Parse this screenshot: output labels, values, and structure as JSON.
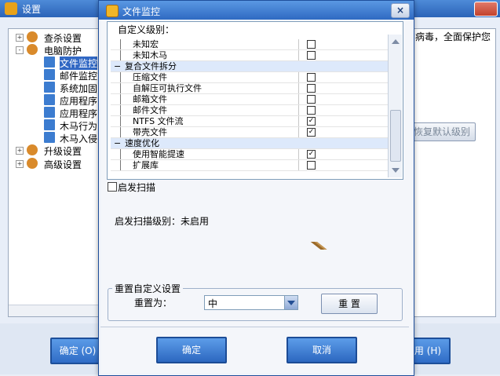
{
  "background_window": {
    "title": "设置",
    "tree": [
      {
        "label": "查杀设置",
        "level": 0,
        "expander": "+"
      },
      {
        "label": "电脑防护",
        "level": 0,
        "expander": "-"
      },
      {
        "label": "文件监控",
        "level": 1
      },
      {
        "label": "邮件监控",
        "level": 1
      },
      {
        "label": "系统加固",
        "level": 1
      },
      {
        "label": "应用程序",
        "level": 1
      },
      {
        "label": "应用程序",
        "level": 1
      },
      {
        "label": "木马行为",
        "level": 1
      },
      {
        "label": "木马入侵",
        "level": 1
      },
      {
        "label": "升级设置",
        "level": 0,
        "expander": "+"
      },
      {
        "label": "高级设置",
        "level": 0,
        "expander": "+"
      }
    ],
    "right_text": "病毒，全面保护您",
    "restore_default_button": "恢复默认级别",
    "ok_button": "确定 (O)",
    "apply_button": "应用 (H)"
  },
  "dialog": {
    "title": "文件监控",
    "close_glyph": "×",
    "custom_level_label": "自定义级别：",
    "rows": [
      {
        "type": "item",
        "name": "未知宏",
        "checked": false
      },
      {
        "type": "item",
        "name": "未知木马",
        "checked": false
      },
      {
        "type": "group",
        "name": "复合文件拆分"
      },
      {
        "type": "item",
        "name": "压缩文件",
        "checked": false
      },
      {
        "type": "item",
        "name": "自解压可执行文件",
        "checked": false
      },
      {
        "type": "item",
        "name": "邮箱文件",
        "checked": false
      },
      {
        "type": "item",
        "name": "邮件文件",
        "checked": false
      },
      {
        "type": "item",
        "name": "NTFS 文件流",
        "checked": true
      },
      {
        "type": "item",
        "name": "带壳文件",
        "checked": true
      },
      {
        "type": "group",
        "name": "速度优化"
      },
      {
        "type": "item",
        "name": "使用智能提速",
        "checked": true
      },
      {
        "type": "item",
        "name": "扩展库",
        "checked": false
      }
    ],
    "launch_scan_label": "启发扫描",
    "launch_scan_checked": false,
    "scan_level_text": "启发扫描级别：未启用",
    "reset_group_title": "重置自定义设置",
    "reset_to_label": "重置为：",
    "reset_value": "中",
    "reset_button": "重 置",
    "ok_button": "确定",
    "cancel_button": "取消"
  },
  "colors": {
    "titlebar": "#2f6ac2",
    "group_row": "#dde9fb",
    "button_blue": "#2c67c0"
  }
}
